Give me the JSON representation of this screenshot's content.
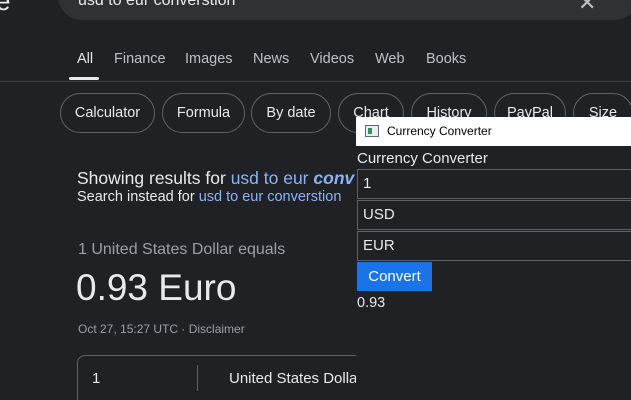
{
  "search": {
    "logo_fragment": "e",
    "query": "usd to eur converstion",
    "clear_icon": "close-icon"
  },
  "tabs": [
    {
      "label": "All",
      "active": true
    },
    {
      "label": "Finance"
    },
    {
      "label": "Images"
    },
    {
      "label": "News"
    },
    {
      "label": "Videos"
    },
    {
      "label": "Web"
    },
    {
      "label": "Books"
    }
  ],
  "chips": [
    "Calculator",
    "Formula",
    "By date",
    "Chart",
    "History",
    "PayPal",
    "Size"
  ],
  "spelling": {
    "showing_prefix": "Showing results for ",
    "corrected_plain": "usd to eur ",
    "corrected_bold": "conv",
    "instead_prefix": "Search instead for ",
    "original_query": "usd to eur converstion"
  },
  "result": {
    "equals_text": "1 United States Dollar equals",
    "value_text": "0.93 Euro",
    "timestamp": "Oct 27, 15:27 UTC",
    "separator": " · ",
    "disclaimer": "Disclaimer",
    "amount": "1",
    "currency": "United States Dolla"
  },
  "converter_window": {
    "title": "Currency Converter",
    "heading": "Currency Converter",
    "amount_value": "1",
    "from_value": "USD",
    "to_value": "EUR",
    "convert_label": "Convert",
    "result_value": "0.93"
  },
  "colors": {
    "background": "#202124",
    "link": "#8ab4f8",
    "button": "#1a73e8"
  }
}
